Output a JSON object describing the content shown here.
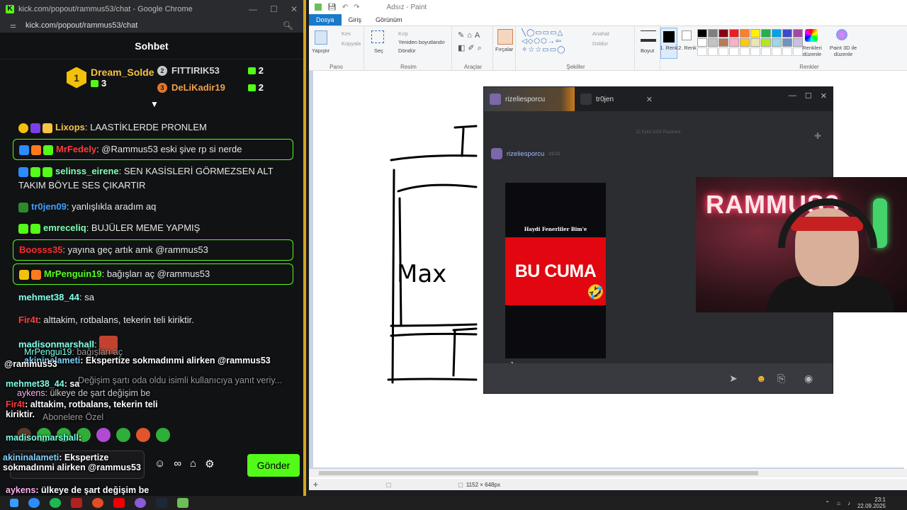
{
  "chrome": {
    "window_title": "kick.com/popout/rammus53/chat - Google Chrome",
    "url": "kick.com/popout/rammus53/chat"
  },
  "chat": {
    "header": "Sohbet",
    "leaderboard": {
      "first": {
        "rank": "1",
        "name": "Dream_Solde",
        "count": "3"
      },
      "second": {
        "rank": "2",
        "name": "FITTIRIK53",
        "count": "2"
      },
      "third": {
        "rank": "3",
        "name": "DeLiKadir19",
        "count": "2"
      }
    },
    "messages": [
      {
        "user": "Lixops",
        "text": ": LAASTİKLERDE PRONLEM",
        "color": "#f6c343",
        "highlight": false
      },
      {
        "user": "MrFedely",
        "text": ": @Rammus53 eski şive rp si nerde",
        "color": "#ff3b3b",
        "highlight": true
      },
      {
        "user": "selinss_eirene",
        "text": ": SEN KASİSLERİ GÖRMEZSEN ALT TAKIM BÖYLE SES ÇIKARTIR",
        "color": "#7dffb2",
        "highlight": false
      },
      {
        "user": "tr0jen09",
        "text": ": yanlışlıkla aradım aq",
        "color": "#3aa0ff",
        "highlight": false
      },
      {
        "user": "emreceliq",
        "text": ": BUJÜLER MEME YAPMIŞ",
        "color": "#7dffb2",
        "highlight": false
      },
      {
        "user": "Boosss35",
        "text": ": yayına geç artık amk @rammus53",
        "color": "#ff2c2c",
        "highlight": true
      },
      {
        "user": "MrPenguin19",
        "text": ": bağışları aç @rammus53",
        "color": "#53fc18",
        "highlight": true
      },
      {
        "user": "mehmet38_44",
        "text": ": sa",
        "color": "#7dffe6",
        "highlight": false
      },
      {
        "user": "Fir4t",
        "text": ": alttakim, rotbalans, tekerin teli kiriktir.",
        "color": "#ff3b3b",
        "highlight": false
      },
      {
        "user": "madisonmarshall",
        "text": ":",
        "color": "#7dffe6",
        "highlight": false
      }
    ],
    "send_button": "Gönder"
  },
  "overlay_chat": [
    {
      "user": "MrPengui19",
      "text": ": bağışları aç"
    },
    {
      "user": "akininalameti",
      "text": ": Ekspertize sokmadınmi alirken @rammus53"
    },
    {
      "user": "",
      "text": "@rammus53"
    },
    {
      "user": "",
      "text": "Değişim şartı oda oldu isimli kullanıcıya yanıt veriy..."
    },
    {
      "user": "mehmet38_44",
      "text": ": sa"
    },
    {
      "user": "aykens",
      "text": ": ülkeye de şart değişim be"
    },
    {
      "user": "Fir4t",
      "text": ": alttakim, rotbalans, tekerin teli kiriktir."
    },
    {
      "user": "",
      "text": "Abonelere Özel"
    },
    {
      "user": "madisonmarshall",
      "text": ":"
    },
    {
      "user": "akininalameti",
      "text": ": Ekspertize sokmadınmi alirken @rammus53"
    },
    {
      "user": "aykens",
      "text": ": ülkeye de şart değişim be"
    }
  ],
  "paint": {
    "title": "Adsız - Paint",
    "tabs": [
      "Dosya",
      "Giriş",
      "Görünüm"
    ],
    "groups": {
      "clipboard": {
        "paste": "Yapıştır",
        "cut": "Kes",
        "copy": "Kopyala",
        "label": "Pano"
      },
      "image": {
        "select": "Seç",
        "crop": "Kırp",
        "resize": "Yeniden boyutlandır",
        "rotate": "Döndür",
        "label": "Resim"
      },
      "tools": {
        "label": "Araçlar"
      },
      "brushes": {
        "label": "Fırçalar"
      },
      "shapes": {
        "outline": "Anahat",
        "fill": "Doldur",
        "label": "Şekiller"
      },
      "size": {
        "label": "Boyut"
      },
      "colors": {
        "color1": "1. Renk",
        "color2": "2. Renk",
        "edit": "Renkleri düzenle",
        "paint3d": "Paint 3D ile düzenle",
        "label": "Renkler"
      }
    },
    "drawing_text": "Max",
    "status_size": "1152 × 648px"
  },
  "discord": {
    "tabs": [
      {
        "name": "rizeliesporcu",
        "active": true
      },
      {
        "name": "tr0jen",
        "active": false
      }
    ],
    "date_separator": "22 Eylül 2025 Pazartesi",
    "author": "rizeliesporcu",
    "time": "23:21",
    "video": {
      "caption": "Haydi Fenerliler Bim'e",
      "headline": "BU CUMA",
      "emoji": "🤣"
    }
  },
  "webcam": {
    "neon_text": "RAMMUS3"
  },
  "taskbar": {
    "time": "23:1",
    "date": "22.09.2025"
  },
  "colors": {
    "kick_green": "#53fc18",
    "paint_blue": "#1979ca",
    "discord_bg": "#313338"
  }
}
